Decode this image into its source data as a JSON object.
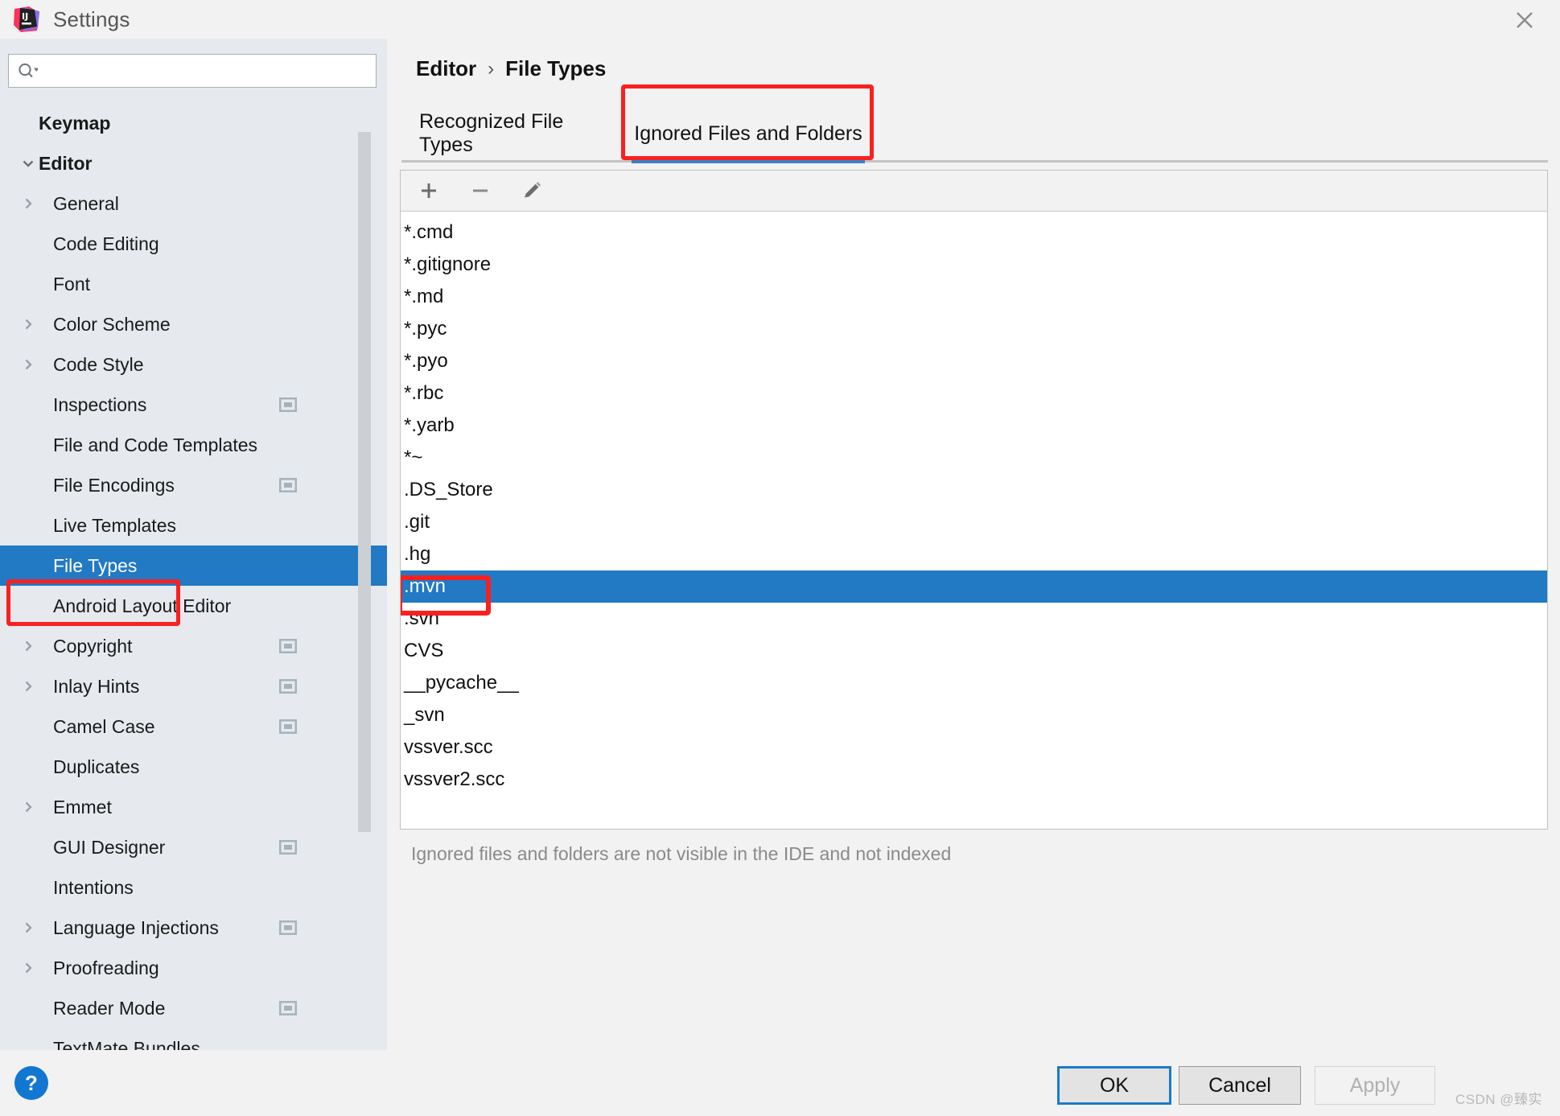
{
  "window": {
    "title": "Settings",
    "logo_icon": "intellij-idea-logo",
    "close_icon": "close-icon"
  },
  "sidebar": {
    "search": {
      "placeholder": "",
      "value": "",
      "icon": "search-icon"
    },
    "items": [
      {
        "label": "Keymap",
        "level": 0,
        "bold": true,
        "twisty": "none",
        "badge": false
      },
      {
        "label": "Editor",
        "level": 0,
        "bold": true,
        "twisty": "expanded",
        "badge": false
      },
      {
        "label": "General",
        "level": 1,
        "bold": false,
        "twisty": "collapsed",
        "badge": false
      },
      {
        "label": "Code Editing",
        "level": 1,
        "bold": false,
        "twisty": "none",
        "badge": false
      },
      {
        "label": "Font",
        "level": 1,
        "bold": false,
        "twisty": "none",
        "badge": false
      },
      {
        "label": "Color Scheme",
        "level": 1,
        "bold": false,
        "twisty": "collapsed",
        "badge": false
      },
      {
        "label": "Code Style",
        "level": 1,
        "bold": false,
        "twisty": "collapsed",
        "badge": false
      },
      {
        "label": "Inspections",
        "level": 1,
        "bold": false,
        "twisty": "none",
        "badge": true
      },
      {
        "label": "File and Code Templates",
        "level": 1,
        "bold": false,
        "twisty": "none",
        "badge": false
      },
      {
        "label": "File Encodings",
        "level": 1,
        "bold": false,
        "twisty": "none",
        "badge": true
      },
      {
        "label": "Live Templates",
        "level": 1,
        "bold": false,
        "twisty": "none",
        "badge": false
      },
      {
        "label": "File Types",
        "level": 1,
        "bold": false,
        "twisty": "none",
        "badge": false,
        "selected": true
      },
      {
        "label": "Android Layout Editor",
        "level": 1,
        "bold": false,
        "twisty": "none",
        "badge": false
      },
      {
        "label": "Copyright",
        "level": 1,
        "bold": false,
        "twisty": "collapsed",
        "badge": true
      },
      {
        "label": "Inlay Hints",
        "level": 1,
        "bold": false,
        "twisty": "collapsed",
        "badge": true
      },
      {
        "label": "Camel Case",
        "level": 1,
        "bold": false,
        "twisty": "none",
        "badge": true
      },
      {
        "label": "Duplicates",
        "level": 1,
        "bold": false,
        "twisty": "none",
        "badge": false
      },
      {
        "label": "Emmet",
        "level": 1,
        "bold": false,
        "twisty": "collapsed",
        "badge": false
      },
      {
        "label": "GUI Designer",
        "level": 1,
        "bold": false,
        "twisty": "none",
        "badge": true
      },
      {
        "label": "Intentions",
        "level": 1,
        "bold": false,
        "twisty": "none",
        "badge": false
      },
      {
        "label": "Language Injections",
        "level": 1,
        "bold": false,
        "twisty": "collapsed",
        "badge": true
      },
      {
        "label": "Proofreading",
        "level": 1,
        "bold": false,
        "twisty": "collapsed",
        "badge": false
      },
      {
        "label": "Reader Mode",
        "level": 1,
        "bold": false,
        "twisty": "none",
        "badge": true
      },
      {
        "label": "TextMate Bundles",
        "level": 1,
        "bold": false,
        "twisty": "none",
        "badge": false
      }
    ]
  },
  "main": {
    "breadcrumb": {
      "parent": "Editor",
      "separator": "›",
      "current": "File Types"
    },
    "tabs": [
      {
        "label": "Recognized File Types",
        "active": false
      },
      {
        "label": "Ignored Files and Folders",
        "active": true
      }
    ],
    "toolbar": [
      {
        "name": "add-button",
        "icon": "plus-icon"
      },
      {
        "name": "remove-button",
        "icon": "minus-icon"
      },
      {
        "name": "edit-button",
        "icon": "pencil-icon"
      }
    ],
    "ignored_list": [
      {
        "value": "*.cmd",
        "selected": false
      },
      {
        "value": "*.gitignore",
        "selected": false
      },
      {
        "value": "*.md",
        "selected": false
      },
      {
        "value": "*.pyc",
        "selected": false
      },
      {
        "value": "*.pyo",
        "selected": false
      },
      {
        "value": "*.rbc",
        "selected": false
      },
      {
        "value": "*.yarb",
        "selected": false
      },
      {
        "value": "*~",
        "selected": false
      },
      {
        "value": ".DS_Store",
        "selected": false
      },
      {
        "value": ".git",
        "selected": false
      },
      {
        "value": ".hg",
        "selected": false
      },
      {
        "value": ".mvn",
        "selected": true
      },
      {
        "value": ".svn",
        "selected": false
      },
      {
        "value": "CVS",
        "selected": false
      },
      {
        "value": "__pycache__",
        "selected": false
      },
      {
        "value": "_svn",
        "selected": false
      },
      {
        "value": "vssver.scc",
        "selected": false
      },
      {
        "value": "vssver2.scc",
        "selected": false
      }
    ],
    "hint": "Ignored files and folders are not visible in the IDE and not indexed"
  },
  "footer": {
    "help_label": "?",
    "ok_label": "OK",
    "cancel_label": "Cancel",
    "apply_label": "Apply",
    "watermark": "CSDN @臻实"
  },
  "colors": {
    "accent_blue": "#2279c4",
    "highlight_red": "#fb2020",
    "sidebar_bg": "#e6eaee",
    "panel_bg": "#f2f2f2"
  }
}
